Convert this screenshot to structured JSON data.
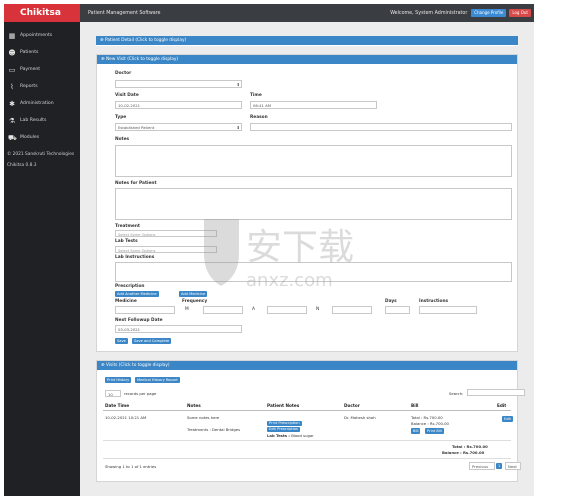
{
  "app": {
    "brand": "Chikitsa",
    "title": "Patient Management Software",
    "welcome": "Welcome, System Administrator",
    "change_profile": "Change Profile",
    "logout": "Log Out"
  },
  "sidebar": {
    "items": [
      {
        "label": "Appointments",
        "icon": "calendar-icon"
      },
      {
        "label": "Patients",
        "icon": "users-icon"
      },
      {
        "label": "Payment",
        "icon": "money-icon"
      },
      {
        "label": "Reports",
        "icon": "chart-icon"
      },
      {
        "label": "Administration",
        "icon": "gear-icon"
      },
      {
        "label": "Lab Results",
        "icon": "flask-icon"
      },
      {
        "label": "Modules",
        "icon": "cart-icon"
      }
    ],
    "copyright": "© 2021 Sanskruti Technologies",
    "version": "Chikitsa 0.8.3"
  },
  "patient_detail": {
    "header": "Patient Detail (Click to toggle display)"
  },
  "new_visit": {
    "header": "New Visit (Click to toggle display)",
    "doctor_label": "Doctor",
    "visit_date_label": "Visit Date",
    "visit_date_value": "10-02-2021",
    "time_label": "Time",
    "time_value": "06:41 AM",
    "type_label": "Type",
    "type_value": "Established Patient",
    "reason_label": "Reason",
    "notes_label": "Notes",
    "notes_patient_label": "Notes for Patient",
    "treatment_label": "Treatment",
    "treatment_placeholder": "Select Some Options",
    "lab_tests_label": "Lab Tests",
    "lab_tests_placeholder": "Select Some Options",
    "lab_instructions_label": "Lab Instructions",
    "prescription_label": "Prescription",
    "add_another_medicine": "Add Another Medicine",
    "add_medicine": "Add Medicine",
    "medicine_label": "Medicine",
    "frequency_label": "Frequency",
    "freq_m": "M",
    "freq_a": "A",
    "freq_n": "N",
    "days_label": "Days",
    "instructions_label": "Instructions",
    "followup_label": "Next Followup Date",
    "followup_value": "03-03-2021",
    "save": "Save",
    "save_complete": "Save and Complete"
  },
  "visits": {
    "header": "Visits (Click to toggle display)",
    "print_history": "Print History",
    "medical_history": "Medical History Report",
    "entries_value": "10",
    "entries_label": "records per page",
    "search_label": "Search:",
    "columns": [
      "Date Time",
      "Notes",
      "Patient Notes",
      "Doctor",
      "Bill",
      "Edit"
    ],
    "row": {
      "datetime": "10-02-2021 10:21 AM",
      "notes1": "Some notes here",
      "notes2": "Treatments : Dental Bridges",
      "print_prescription": "Print Prescription",
      "edit_prescription": "Edit Prescription",
      "lab_tests": "Lab Tests : ",
      "lab_tests_value": "Blood sugar",
      "doctor": "Dr. Mahesh shah",
      "total": "Total : Rs.700.00",
      "balance": "Balance : Rs.700.00",
      "bill_btn": "Bill",
      "print_bill": "Print Bill",
      "edit": "Edit"
    },
    "footer_total": "Total : Rs.700.00",
    "footer_balance": "Balance : Rs.700.00",
    "showing": "Showing 1 to 1 of 1 entries",
    "prev": "Previous",
    "page": "1",
    "next": "Next"
  },
  "watermark": {
    "text": "安下载",
    "sub": "anxz.com"
  }
}
